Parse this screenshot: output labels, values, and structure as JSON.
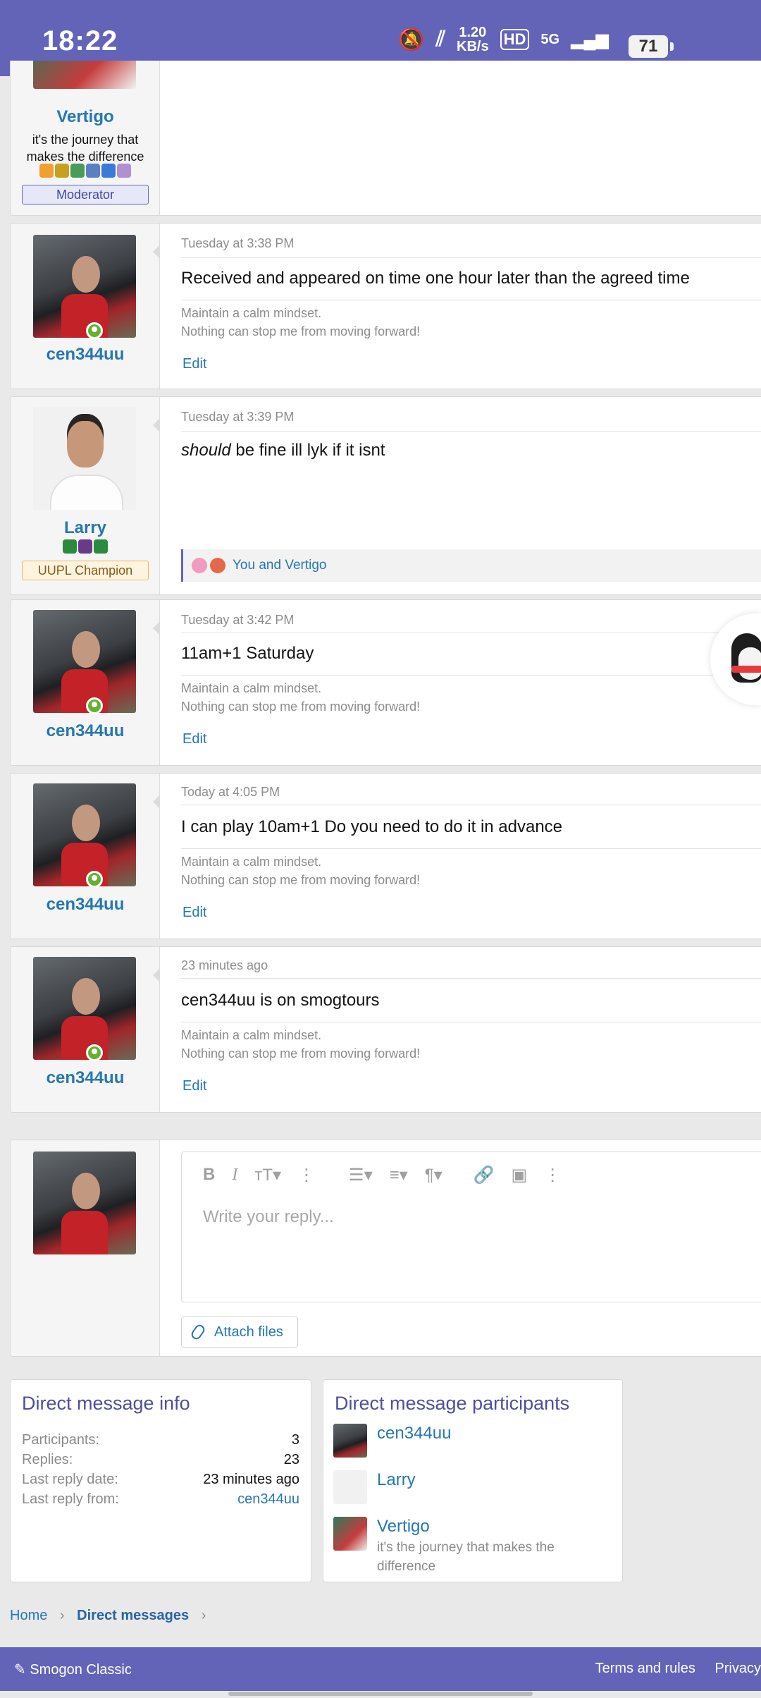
{
  "status_bar": {
    "time": "18:22",
    "speed_value": "1.20",
    "speed_unit": "KB/s",
    "hd_label": "HD",
    "network": "5G",
    "battery": "71"
  },
  "posts": [
    {
      "author": "Vertigo",
      "user_title": "it's the journey that makes the difference",
      "banner": "Moderator"
    },
    {
      "author": "cen344uu",
      "date": "Tuesday at 3:38 PM",
      "body": "Received and appeared on time one hour later than the agreed time",
      "signature": [
        "Maintain a calm mindset.",
        "Nothing can stop me from moving forward!"
      ],
      "edit_label": "Edit"
    },
    {
      "author": "Larry",
      "date": "Tuesday at 3:39 PM",
      "body_emphasis": "should",
      "body_rest": " be fine ill lyk if it isnt",
      "banner": "UUPL Champion",
      "reactions": "You and Vertigo"
    },
    {
      "author": "cen344uu",
      "date": "Tuesday at 3:42 PM",
      "body": "11am+1 Saturday",
      "signature": [
        "Maintain a calm mindset.",
        "Nothing can stop me from moving forward!"
      ],
      "edit_label": "Edit"
    },
    {
      "author": "cen344uu",
      "date": "Today at 4:05 PM",
      "body": "I can play 10am+1 Do you need to do it in advance",
      "signature": [
        "Maintain a calm mindset.",
        "Nothing can stop me from moving forward!"
      ],
      "edit_label": "Edit"
    },
    {
      "author": "cen344uu",
      "date": "23 minutes ago",
      "body": "cen344uu is on smogtours",
      "signature": [
        "Maintain a calm mindset.",
        "Nothing can stop me from moving forward!"
      ],
      "edit_label": "Edit"
    }
  ],
  "reply": {
    "placeholder": "Write your reply...",
    "attach_label": "Attach files"
  },
  "dm_info": {
    "title": "Direct message info",
    "rows": [
      {
        "label": "Participants:",
        "value": "3"
      },
      {
        "label": "Replies:",
        "value": "23"
      },
      {
        "label": "Last reply date:",
        "value": "23 minutes ago"
      },
      {
        "label": "Last reply from:",
        "value": "cen344uu"
      }
    ]
  },
  "dm_participants": {
    "title": "Direct message participants",
    "items": [
      {
        "name": "cen344uu",
        "title": ""
      },
      {
        "name": "Larry",
        "title": ""
      },
      {
        "name": "Vertigo",
        "title": "it's the journey that makes the difference"
      }
    ]
  },
  "breadcrumb": {
    "home": "Home",
    "section": "Direct messages"
  },
  "footer": {
    "brand": "Smogon Classic",
    "terms": "Terms and rules",
    "privacy": "Privacy"
  },
  "colors": {
    "accent": "#6364b8",
    "link": "#2577b1",
    "online": "#63b132"
  }
}
